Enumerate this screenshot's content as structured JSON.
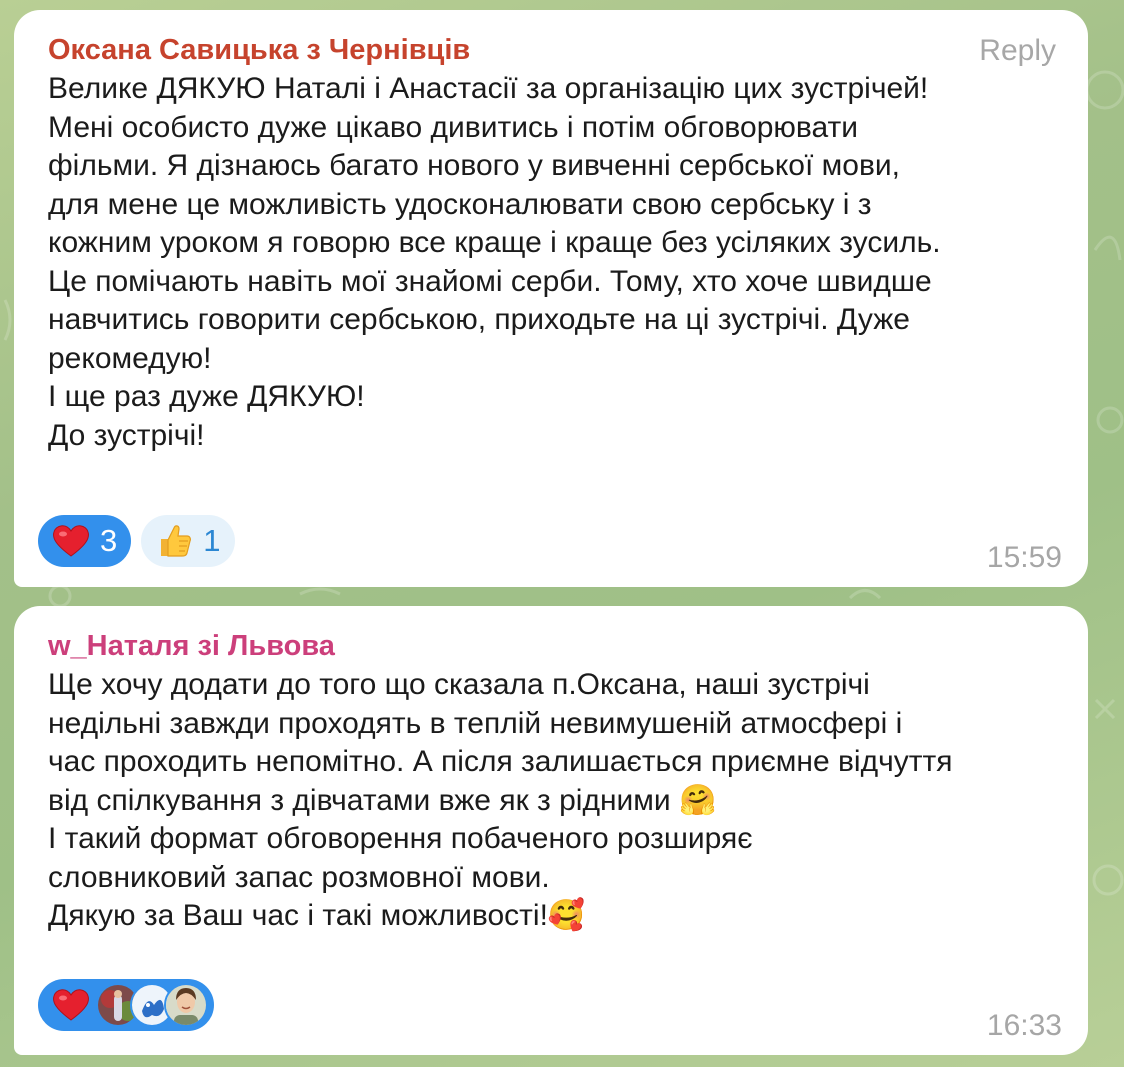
{
  "messages": [
    {
      "sender": "Оксана Савицька з Чернівців",
      "sender_color": "#c6432d",
      "reply_label": "Reply",
      "lines": [
        "Велике ДЯКУЮ Наталі і Анастасії за організацію цих зустрічей!",
        "Мені особисто дуже цікаво дивитись і потім обговорювати",
        "фільми. Я дізнаюсь багато нового у вивченні сербської мови,",
        "для мене це можливість удосконалювати свою сербську і з",
        "кожним уроком я говорю все краще і краще без усіляких зусиль.",
        "Це помічають навіть мої знайомі серби. Тому, хто хоче швидше",
        "навчитись говорити сербською, приходьте на ці зустрічі. Дуже",
        "рекомедую!",
        "І ще раз дуже ДЯКУЮ!",
        "До зустрічі!"
      ],
      "reactions": [
        {
          "icon": "heart-icon",
          "count": "3"
        },
        {
          "icon": "thumbs-up-icon",
          "count": "1"
        }
      ],
      "time": "15:59"
    },
    {
      "sender": "w_Наталя зі Львова",
      "sender_color": "#cc3f7b",
      "lines": [
        "Ще хочу додати до того що сказала п.Оксана, наші зустрічі",
        "недільні завжди проходять в теплій невимушеній атмосфері і",
        "час проходить непомітно. А після залишається приємне відчуття",
        "від спілкування з дівчатами вже як з рідними 🤗",
        "І такий формат обговорення побаченого розширяє",
        "словниковий запас розмовної мови.",
        "Дякую за Ваш час і такі можливості!🥰"
      ],
      "reactions": [
        {
          "icon": "heart-icon",
          "avatars": [
            "avatar-user-1",
            "avatar-user-2",
            "avatar-user-3"
          ]
        }
      ],
      "time": "16:33"
    }
  ],
  "colors": {
    "reaction_active_bg": "#3390ec",
    "reaction_inactive_bg": "#e6f2fb",
    "time_color": "#a6a6a6"
  }
}
